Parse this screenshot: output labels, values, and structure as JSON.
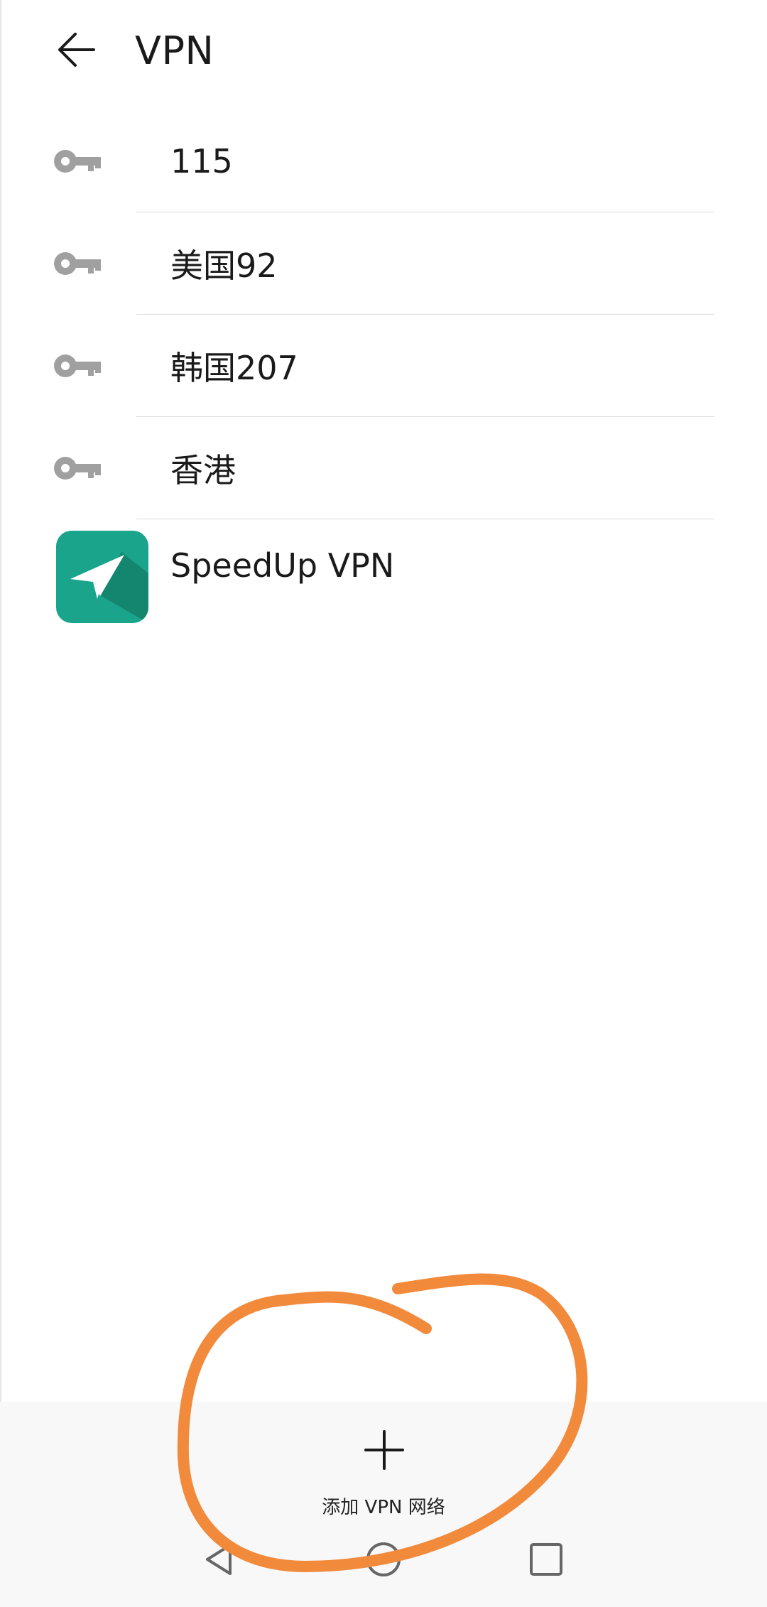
{
  "header": {
    "title": "VPN",
    "back_icon": "arrow-left-icon"
  },
  "vpn_list": [
    {
      "label": "115",
      "icon": "key-icon"
    },
    {
      "label": "美国92",
      "icon": "key-icon"
    },
    {
      "label": "韩国207",
      "icon": "key-icon"
    },
    {
      "label": "香港",
      "icon": "key-icon"
    }
  ],
  "app": {
    "label": "SpeedUp VPN",
    "icon": "paper-plane-icon"
  },
  "add_vpn": {
    "label": "添加 VPN 网络",
    "icon": "plus-icon"
  },
  "colors": {
    "app_icon": "#1aa48b",
    "annotation": "#f28a3c",
    "key_icon": "#a0a0a0"
  }
}
